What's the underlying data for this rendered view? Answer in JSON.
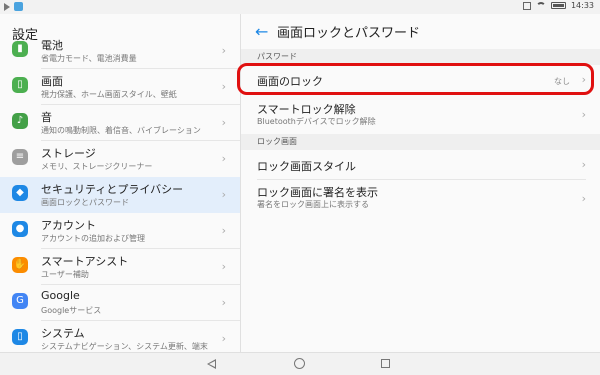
{
  "status_bar": {
    "time": "14:33"
  },
  "left_pane": {
    "title": "設定",
    "items": [
      {
        "title": "電池",
        "subtitle": "省電力モード、電池消費量",
        "icon": "battery-icon",
        "icon_color": "#4caf50",
        "glyph": "▮"
      },
      {
        "title": "画面",
        "subtitle": "視力保護、ホーム画面スタイル、壁紙",
        "icon": "display-icon",
        "icon_color": "#4caf50",
        "glyph": "▯"
      },
      {
        "title": "音",
        "subtitle": "通知の鳴動制限、着信音、バイブレーション",
        "icon": "sound-icon",
        "icon_color": "#43a047",
        "glyph": "♪"
      },
      {
        "title": "ストレージ",
        "subtitle": "メモリ、ストレージクリーナー",
        "icon": "storage-icon",
        "icon_color": "#9e9e9e",
        "glyph": "≡"
      },
      {
        "title": "セキュリティとプライバシー",
        "subtitle": "画面ロックとパスワード",
        "icon": "shield-icon",
        "icon_color": "#1e88e5",
        "glyph": "◆"
      },
      {
        "title": "アカウント",
        "subtitle": "アカウントの追加および管理",
        "icon": "account-icon",
        "icon_color": "#1e88e5",
        "glyph": "●"
      },
      {
        "title": "スマートアシスト",
        "subtitle": "ユーザー補助",
        "icon": "hand-icon",
        "icon_color": "#fb8c00",
        "glyph": "✋"
      },
      {
        "title": "Google",
        "subtitle": "Googleサービス",
        "icon": "google-icon",
        "icon_color": "#4285f4",
        "glyph": "G"
      },
      {
        "title": "システム",
        "subtitle": "システムナビゲーション、システム更新、端末",
        "icon": "system-icon",
        "icon_color": "#1e88e5",
        "glyph": "▯"
      }
    ],
    "selected_index": 4
  },
  "right_pane": {
    "title": "画面ロックとパスワード",
    "sections": [
      {
        "header": "パスワード"
      },
      {
        "header": "ロック画面"
      }
    ],
    "items": [
      {
        "title": "画面のロック",
        "value": "なし"
      },
      {
        "title": "スマートロック解除",
        "subtitle": "Bluetoothデバイスでロック解除"
      },
      {
        "title": "ロック画面スタイル"
      },
      {
        "title": "ロック画面に署名を表示",
        "subtitle": "署名をロック画面上に表示する"
      }
    ]
  },
  "colors": {
    "accent": "#1e88e5",
    "highlight": "#e01010",
    "selected_bg": "#e3eefb"
  }
}
